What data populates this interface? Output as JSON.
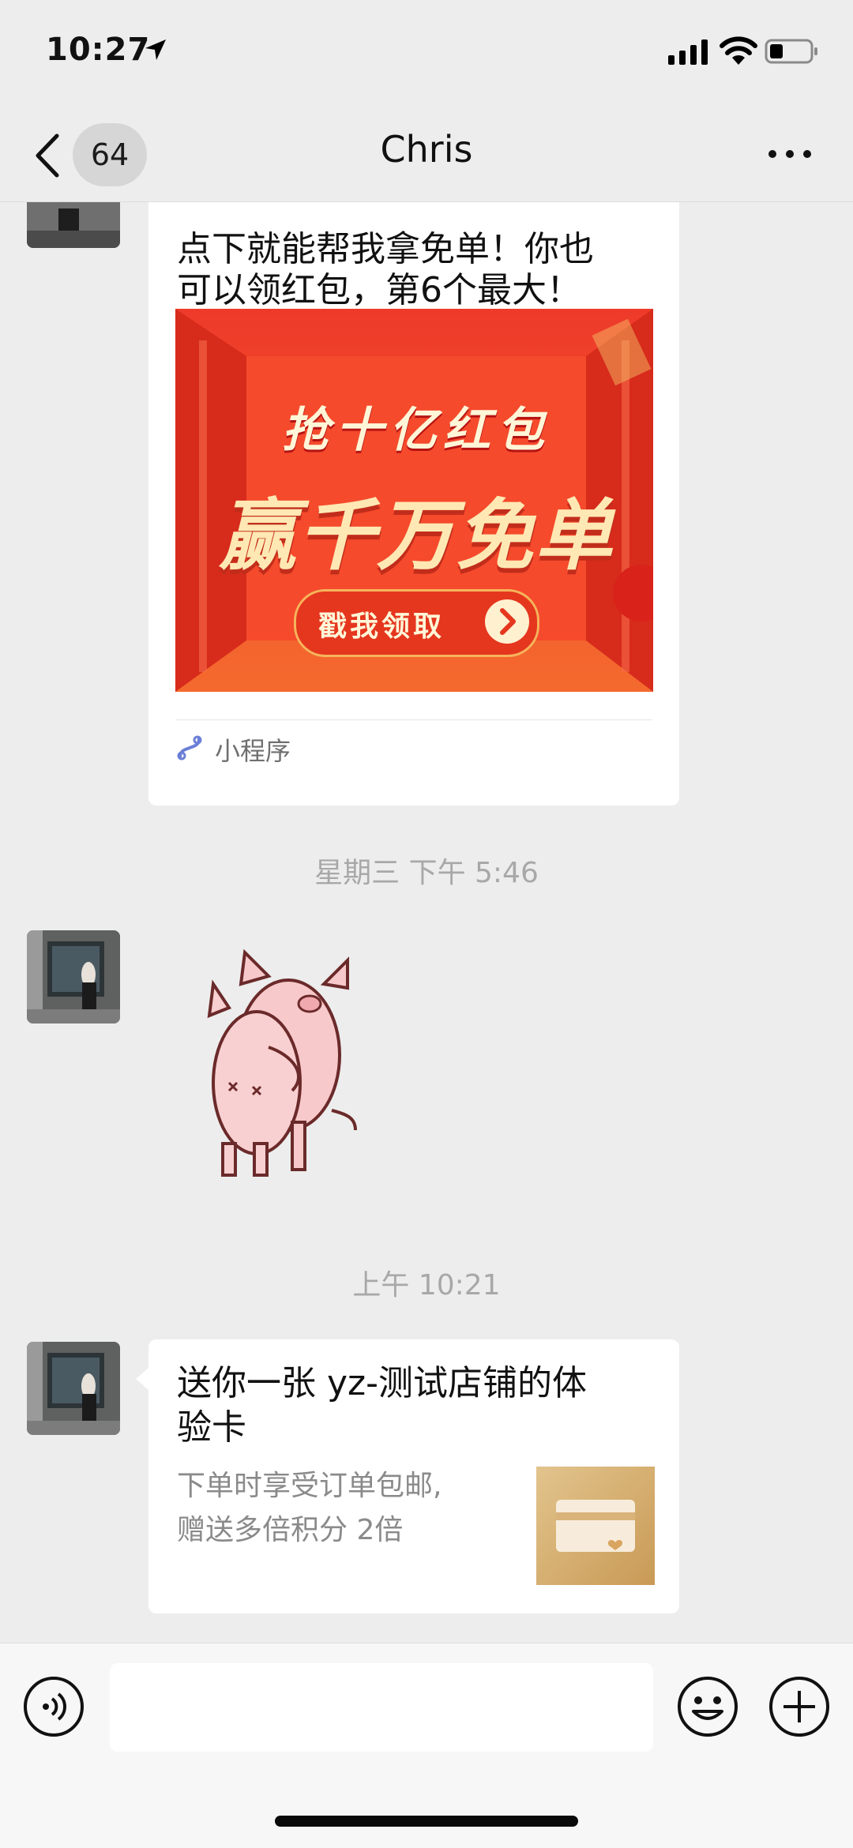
{
  "status_bar": {
    "time": "10:27"
  },
  "nav": {
    "unread_count": "64",
    "title": "Chris"
  },
  "messages": {
    "miniprogram": {
      "title_line1": "点下就能帮我拿免单！你也",
      "title_line2": "可以领红包，第6个最大！",
      "promo_line1": "抢十亿红包",
      "promo_line2": "赢千万免单",
      "promo_button": "戳我领取",
      "label": "小程序"
    },
    "timestamp1": "星期三 下午 5:46",
    "timestamp2": "上午 10:21",
    "card": {
      "title_line1": "送你一张 yz-测试店铺的体",
      "title_line2": "验卡",
      "sub_line1": "下单时享受订单包邮,",
      "sub_line2": "赠送多倍积分 2倍"
    }
  },
  "input": {
    "placeholder": ""
  },
  "colors": {
    "background": "#ededed",
    "bubble": "#ffffff",
    "promo_red": "#f0392a"
  },
  "icons": [
    "location-arrow-icon",
    "signal-icon",
    "wifi-icon",
    "battery-icon",
    "back-chevron-icon",
    "more-icon",
    "miniprogram-icon",
    "voice-icon",
    "emoji-icon",
    "plus-icon"
  ]
}
